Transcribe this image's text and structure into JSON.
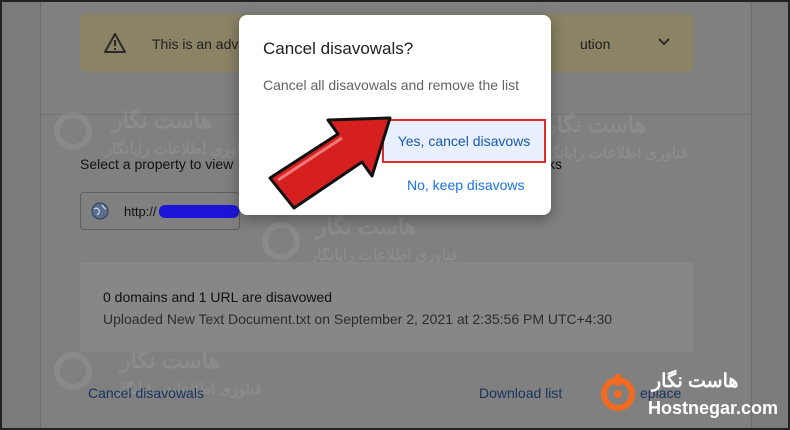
{
  "warning": {
    "text": "This is an adv",
    "tail": "ution"
  },
  "property": {
    "label": "Select a property to view",
    "label_tail": "ks",
    "url_prefix": "http://"
  },
  "summary": {
    "count_line": "0 domains and 1 URL are disavowed",
    "upload_line": "Uploaded New Text Document.txt on September 2, 2021 at 2:35:56 PM UTC+4:30"
  },
  "actions": {
    "cancel": "Cancel disavowals",
    "download": "Download list",
    "replace": "eplace"
  },
  "dialog": {
    "title": "Cancel disavowals?",
    "body": "Cancel all disavowals and remove the list",
    "confirm": "Yes, cancel disavows",
    "dismiss": "No, keep disavows"
  },
  "watermark": {
    "brand_fa": "هاست نگار",
    "tagline_fa": "فناوری اطلاعات رایانگار"
  },
  "brand": {
    "name_fa": "هاست نگار",
    "domain": "Hostnegar.com"
  },
  "colors": {
    "highlight_border": "#e02b2b",
    "arrow": "#d61f1f",
    "link": "#1a73e8",
    "brand_orange": "#f26a21"
  }
}
